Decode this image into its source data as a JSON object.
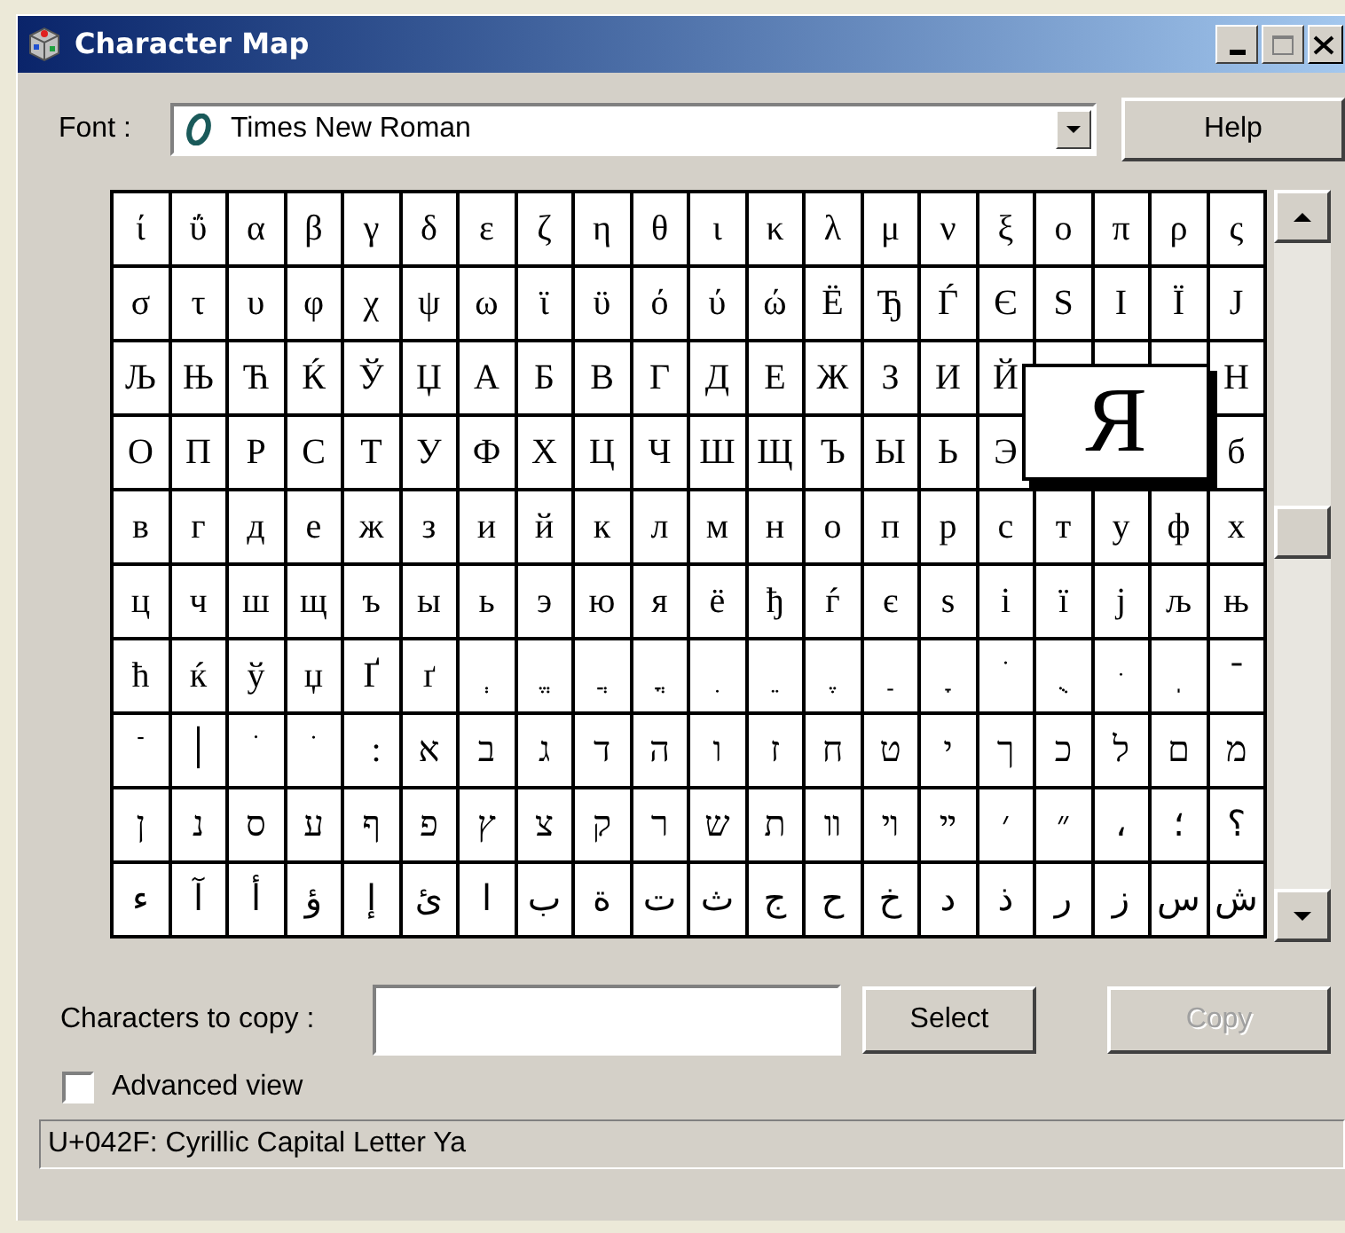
{
  "window": {
    "title": "Character Map"
  },
  "font": {
    "label": "Font :",
    "value": "Times New Roman"
  },
  "help_button": {
    "label": "Help"
  },
  "grid": {
    "rows": [
      [
        "ί",
        "ΰ",
        "α",
        "β",
        "γ",
        "δ",
        "ε",
        "ζ",
        "η",
        "θ",
        "ι",
        "κ",
        "λ",
        "μ",
        "ν",
        "ξ",
        "ο",
        "π",
        "ρ",
        "ς"
      ],
      [
        "σ",
        "τ",
        "υ",
        "φ",
        "χ",
        "ψ",
        "ω",
        "ϊ",
        "ϋ",
        "ό",
        "ύ",
        "ώ",
        "Ё",
        "Ђ",
        "Ѓ",
        "Є",
        "Ѕ",
        "І",
        "Ї",
        "Ј"
      ],
      [
        "Љ",
        "Њ",
        "Ћ",
        "Ќ",
        "Ў",
        "Џ",
        "А",
        "Б",
        "В",
        "Г",
        "Д",
        "Е",
        "Ж",
        "З",
        "И",
        "Й",
        null,
        null,
        null,
        "Н"
      ],
      [
        "О",
        "П",
        "Р",
        "С",
        "Т",
        "У",
        "Ф",
        "Х",
        "Ц",
        "Ч",
        "Ш",
        "Щ",
        "Ъ",
        "Ы",
        "Ь",
        "Э",
        null,
        null,
        null,
        "б"
      ],
      [
        "в",
        "г",
        "д",
        "е",
        "ж",
        "з",
        "и",
        "й",
        "к",
        "л",
        "м",
        "н",
        "о",
        "п",
        "р",
        "с",
        "т",
        "у",
        "ф",
        "х"
      ],
      [
        "ц",
        "ч",
        "ш",
        "щ",
        "ъ",
        "ы",
        "ь",
        "э",
        "ю",
        "я",
        "ё",
        "ђ",
        "ѓ",
        "є",
        "ѕ",
        "і",
        "ї",
        "ј",
        "љ",
        "њ"
      ],
      [
        "ћ",
        "ќ",
        "ў",
        "џ",
        "Ґ",
        "ґ",
        "ְ",
        "ֱ",
        "ֲ",
        "ֳ",
        "ִ",
        "ֵ",
        "ֶ",
        "ַ",
        "ָ",
        "ֹ",
        "ֻ",
        "ּ",
        "ֽ",
        "־"
      ],
      [
        "ֿ",
        "׀",
        "ׁ",
        "ׂ",
        "׃",
        "א",
        "ב",
        "ג",
        "ד",
        "ה",
        "ו",
        "ז",
        "ח",
        "ט",
        "י",
        "ך",
        "כ",
        "ל",
        "ם",
        "מ"
      ],
      [
        "ן",
        "נ",
        "ס",
        "ע",
        "ף",
        "פ",
        "ץ",
        "צ",
        "ק",
        "ר",
        "ש",
        "ת",
        "װ",
        "ױ",
        "ײ",
        "׳",
        "״",
        "،",
        "؛",
        "؟"
      ],
      [
        "ء",
        "آ",
        "أ",
        "ؤ",
        "إ",
        "ئ",
        "ا",
        "ب",
        "ة",
        "ت",
        "ث",
        "ج",
        "ح",
        "خ",
        "د",
        "ذ",
        "ر",
        "ز",
        "س",
        "ش"
      ]
    ]
  },
  "magnified": {
    "char": "Я"
  },
  "copy_field": {
    "label": "Characters to copy :"
  },
  "buttons": [
    {
      "label": "Select",
      "disabled": false
    },
    {
      "label": "Copy",
      "disabled": true
    }
  ],
  "advanced_view": {
    "label": "Advanced view",
    "checked": false
  },
  "status_bar": "U+042F: Cyrillic Capital Letter Ya"
}
